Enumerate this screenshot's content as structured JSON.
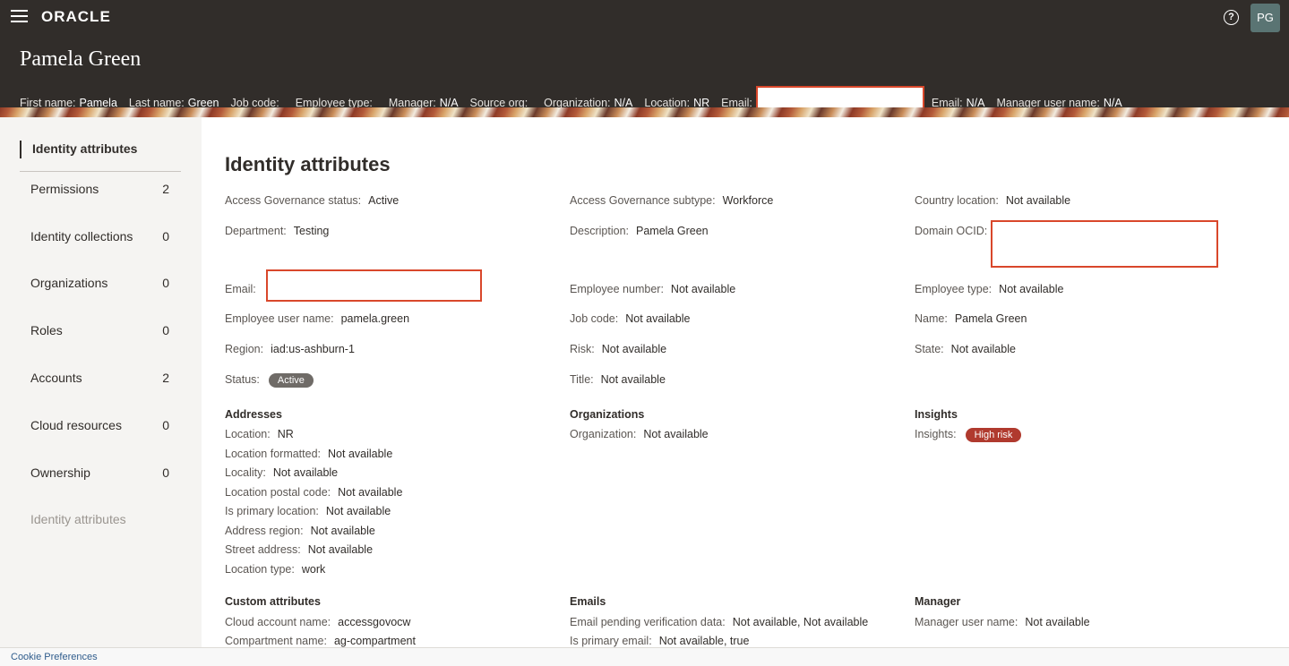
{
  "topbar": {
    "logo": "ORACLE",
    "help_glyph": "?",
    "avatar_initials": "PG"
  },
  "header": {
    "name": "Pamela Green",
    "summary": {
      "first_name_label": "First name:",
      "first_name": "Pamela",
      "last_name_label": "Last name:",
      "last_name": "Green",
      "job_code_label": "Job code:",
      "employee_type_label": "Employee type:",
      "manager_label": "Manager:",
      "manager": "N/A",
      "source_org_label": "Source org:",
      "organization_label": "Organization:",
      "organization": "N/A",
      "location_label": "Location:",
      "location": "NR",
      "email_label": "Email:",
      "email2_label": "Email:",
      "email2": "N/A",
      "manager_user_name_label": "Manager user name:",
      "manager_user_name": "N/A"
    }
  },
  "sidebar": {
    "active": "Identity attributes",
    "items": [
      {
        "label": "Permissions",
        "count": "2"
      },
      {
        "label": "Identity collections",
        "count": "0"
      },
      {
        "label": "Organizations",
        "count": "0"
      },
      {
        "label": "Roles",
        "count": "0"
      },
      {
        "label": "Accounts",
        "count": "2"
      },
      {
        "label": "Cloud resources",
        "count": "0"
      },
      {
        "label": "Ownership",
        "count": "0"
      },
      {
        "label": "Identity attributes",
        "count": ""
      }
    ]
  },
  "main": {
    "title": "Identity attributes",
    "ag_status": {
      "label": "Access Governance status:",
      "value": "Active"
    },
    "ag_subtype": {
      "label": "Access Governance subtype:",
      "value": "Workforce"
    },
    "country": {
      "label": "Country location:",
      "value": "Not available"
    },
    "department": {
      "label": "Department:",
      "value": "Testing"
    },
    "description": {
      "label": "Description:",
      "value": "Pamela Green"
    },
    "domain_ocid": {
      "label": "Domain OCID:"
    },
    "email": {
      "label": "Email:"
    },
    "employee_number": {
      "label": "Employee number:",
      "value": "Not available"
    },
    "employee_type": {
      "label": "Employee type:",
      "value": "Not available"
    },
    "employee_user_name": {
      "label": "Employee user name:",
      "value": "pamela.green"
    },
    "job_code": {
      "label": "Job code:",
      "value": "Not available"
    },
    "name": {
      "label": "Name:",
      "value": "Pamela Green"
    },
    "region": {
      "label": "Region:",
      "value": "iad:us-ashburn-1"
    },
    "risk": {
      "label": "Risk:",
      "value": "Not available"
    },
    "state": {
      "label": "State:",
      "value": "Not available"
    },
    "status": {
      "label": "Status:",
      "value": "Active"
    },
    "title_field": {
      "label": "Title:",
      "value": "Not available"
    },
    "addresses": {
      "heading": "Addresses",
      "location": {
        "label": "Location:",
        "value": "NR"
      },
      "location_formatted": {
        "label": "Location formatted:",
        "value": "Not available"
      },
      "locality": {
        "label": "Locality:",
        "value": "Not available"
      },
      "postal_code": {
        "label": "Location postal code:",
        "value": "Not available"
      },
      "is_primary": {
        "label": "Is primary location:",
        "value": "Not available"
      },
      "address_region": {
        "label": "Address region:",
        "value": "Not available"
      },
      "street_address": {
        "label": "Street address:",
        "value": "Not available"
      },
      "location_type": {
        "label": "Location type:",
        "value": "work"
      }
    },
    "organizations": {
      "heading": "Organizations",
      "organization": {
        "label": "Organization:",
        "value": "Not available"
      }
    },
    "insights": {
      "heading": "Insights",
      "insights": {
        "label": "Insights:",
        "value": "High risk"
      }
    },
    "custom": {
      "heading": "Custom attributes",
      "cloud_account": {
        "label": "Cloud account name:",
        "value": "accessgovocw"
      },
      "compartment": {
        "label": "Compartment name:",
        "value": "ag-compartment"
      }
    },
    "emails": {
      "heading": "Emails",
      "pending": {
        "label": "Email pending verification data:",
        "value": "Not available, Not available"
      },
      "primary": {
        "label": "Is primary email:",
        "value": "Not available, true"
      }
    },
    "manager": {
      "heading": "Manager",
      "manager_user_name": {
        "label": "Manager user name:",
        "value": "Not available"
      }
    }
  },
  "footer": {
    "cookie_link": "Cookie Preferences"
  }
}
